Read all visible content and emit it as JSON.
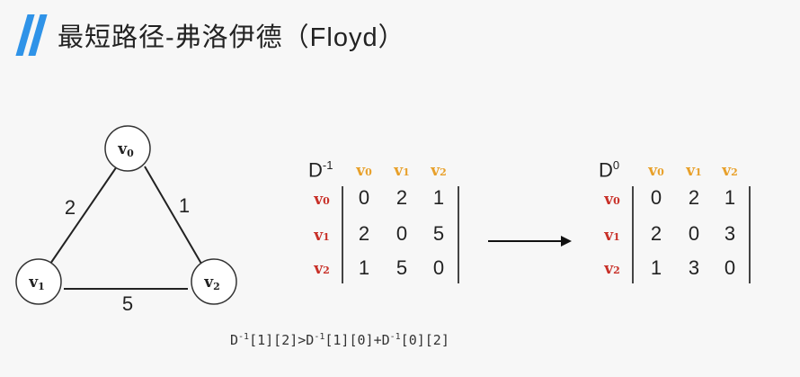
{
  "title": "最短路径-弗洛伊德（Floyd）",
  "graph": {
    "nodes": [
      {
        "id": "v0",
        "label": "v",
        "sub": "0"
      },
      {
        "id": "v1",
        "label": "v",
        "sub": "1"
      },
      {
        "id": "v2",
        "label": "v",
        "sub": "2"
      }
    ],
    "edges": [
      {
        "from": "v0",
        "to": "v1",
        "weight": "2"
      },
      {
        "from": "v0",
        "to": "v2",
        "weight": "1"
      },
      {
        "from": "v1",
        "to": "v2",
        "weight": "5"
      }
    ]
  },
  "matrix_before": {
    "name": "D",
    "sup": "-1",
    "col_headers": [
      {
        "label": "v",
        "sub": "0"
      },
      {
        "label": "v",
        "sub": "1"
      },
      {
        "label": "v",
        "sub": "2"
      }
    ],
    "row_headers": [
      {
        "label": "v",
        "sub": "0"
      },
      {
        "label": "v",
        "sub": "1"
      },
      {
        "label": "v",
        "sub": "2"
      }
    ],
    "rows": [
      [
        "0",
        "2",
        "1"
      ],
      [
        "2",
        "0",
        "5"
      ],
      [
        "1",
        "5",
        "0"
      ]
    ]
  },
  "matrix_after": {
    "name": "D",
    "sup": "0",
    "col_headers": [
      {
        "label": "v",
        "sub": "0"
      },
      {
        "label": "v",
        "sub": "1"
      },
      {
        "label": "v",
        "sub": "2"
      }
    ],
    "row_headers": [
      {
        "label": "v",
        "sub": "0"
      },
      {
        "label": "v",
        "sub": "1"
      },
      {
        "label": "v",
        "sub": "2"
      }
    ],
    "rows": [
      [
        "0",
        "2",
        "1"
      ],
      [
        "2",
        "0",
        "3"
      ],
      [
        "1",
        "3",
        "0"
      ]
    ]
  },
  "formula": {
    "lhs_name": "D",
    "lhs_sup": "-1",
    "lhs_idx": "[1][2]",
    "op": ">",
    "a_name": "D",
    "a_sup": "-1",
    "a_idx": "[1][0]",
    "plus": "+",
    "b_name": "D",
    "b_sup": "-1",
    "b_idx": "[0][2]"
  },
  "colors": {
    "accent": "#2f93e8",
    "col_header": "#e8a02a",
    "row_header": "#c83028"
  }
}
